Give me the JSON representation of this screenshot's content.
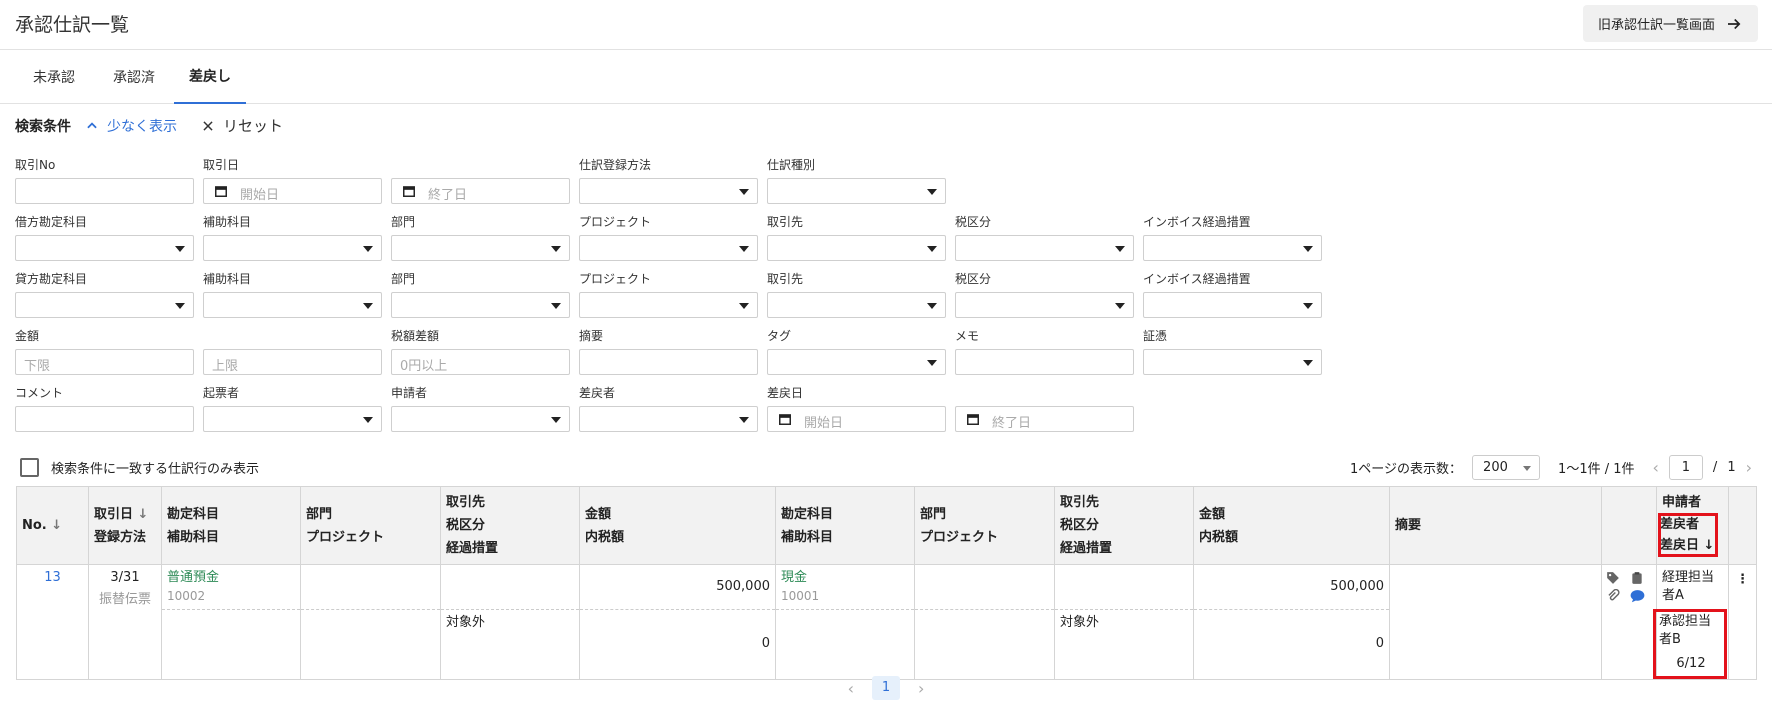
{
  "header": {
    "title": "承認仕訳一覧",
    "old_button_label": "旧承認仕訳一覧画面"
  },
  "tabs": [
    {
      "label": "未承認",
      "active": false
    },
    {
      "label": "承認済",
      "active": false
    },
    {
      "label": "差戻し",
      "active": true
    }
  ],
  "search": {
    "title": "検索条件",
    "show_less": "少なく表示",
    "reset": "リセット",
    "labels": {
      "trade_no": "取引No",
      "trade_date": "取引日",
      "register_method": "仕訳登録方法",
      "journal_type": "仕訳種別",
      "debit_account": "借方勘定科目",
      "debit_sub": "補助科目",
      "debit_dept": "部門",
      "debit_project": "プロジェクト",
      "debit_partner": "取引先",
      "debit_tax": "税区分",
      "debit_invoice": "インボイス経過措置",
      "credit_account": "貸方勘定科目",
      "credit_sub": "補助科目",
      "credit_dept": "部門",
      "credit_project": "プロジェクト",
      "credit_partner": "取引先",
      "credit_tax": "税区分",
      "credit_invoice": "インボイス経過措置",
      "amount": "金額",
      "tax_diff": "税額差額",
      "summary": "摘要",
      "tag": "タグ",
      "memo": "メモ",
      "voucher": "証憑",
      "comment": "コメント",
      "creator": "起票者",
      "applicant": "申請者",
      "returner": "差戻者",
      "return_date": "差戻日"
    },
    "placeholders": {
      "start_date": "開始日",
      "end_date": "終了日",
      "lower": "下限",
      "upper": "上限",
      "zero_or_more": "0円以上"
    },
    "only_matching": "検索条件に一致する仕訳行のみ表示"
  },
  "pagination": {
    "per_page_label": "1ページの表示数：",
    "per_page_value": "200",
    "range": "1〜1件 / 1件",
    "current_page": "1",
    "separator": "/",
    "total_pages": "1"
  },
  "table": {
    "headers": {
      "no": "No.",
      "date": "取引日",
      "method": "登録方法",
      "account": "勘定科目",
      "sub_account": "補助科目",
      "dept": "部門",
      "project": "プロジェクト",
      "partner": "取引先",
      "tax": "税区分",
      "transition": "経過措置",
      "amount": "金額",
      "tax_incl": "内税額",
      "summary": "摘要",
      "applicant": "申請者",
      "returner": "差戻者",
      "return_date": "差戻日"
    },
    "rows": [
      {
        "no": "13",
        "date": "3/31",
        "method": "振替伝票",
        "debit_account": "普通預金",
        "debit_code": "10002",
        "debit_amount": "500,000",
        "debit_tax": "対象外",
        "debit_tax_amount": "0",
        "credit_account": "現金",
        "credit_code": "10001",
        "credit_amount": "500,000",
        "credit_tax": "対象外",
        "credit_tax_amount": "0",
        "applicant": "経理担当者A",
        "returner": "承認担当者B",
        "return_date": "6/12"
      }
    ]
  },
  "bottom_pager": {
    "current": "1"
  },
  "colors": {
    "accent": "#2f6fd6",
    "highlight": "#e3121b",
    "account_green": "#2e8b57"
  }
}
